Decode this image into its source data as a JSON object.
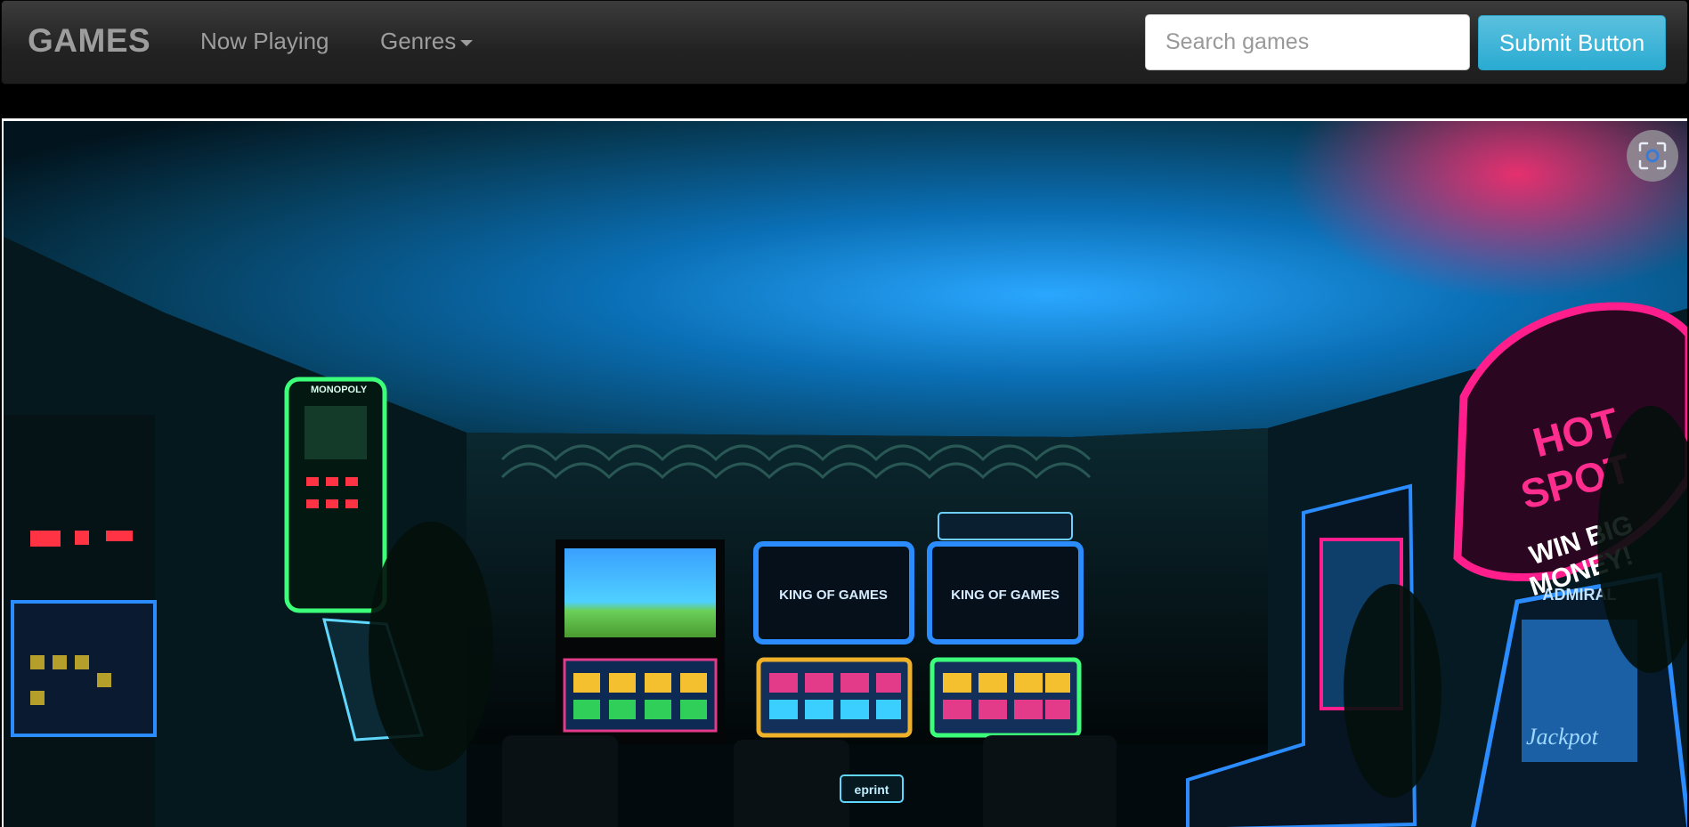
{
  "navbar": {
    "brand": "GAMES",
    "links": [
      {
        "label": "Now Playing"
      },
      {
        "label": "Genres"
      }
    ]
  },
  "search": {
    "placeholder": "Search games",
    "value": ""
  },
  "submit_label": "Submit Button",
  "hero": {
    "alt": "Arcade room with neon slot machines",
    "signs": {
      "hot": "HOT",
      "spot": "SPOT",
      "win": "WIN BIG",
      "money": "MONEY!",
      "king1": "KING OF GAMES",
      "king2": "KING OF GAMES",
      "monopoly": "MONOPOLY",
      "admiral": "ADMIRAL",
      "jackpot": "Jackpot",
      "eprint": "eprint"
    }
  },
  "colors": {
    "navbar_bg": "#222222",
    "nav_text": "#9d9d9d",
    "button_bg": "#5bc0de",
    "neon_pink": "#ff1e8c",
    "neon_blue": "#2a8cff",
    "neon_green": "#3cff7a"
  },
  "icons": {
    "lens": "visual-search-icon",
    "caret": "caret-down-icon"
  }
}
